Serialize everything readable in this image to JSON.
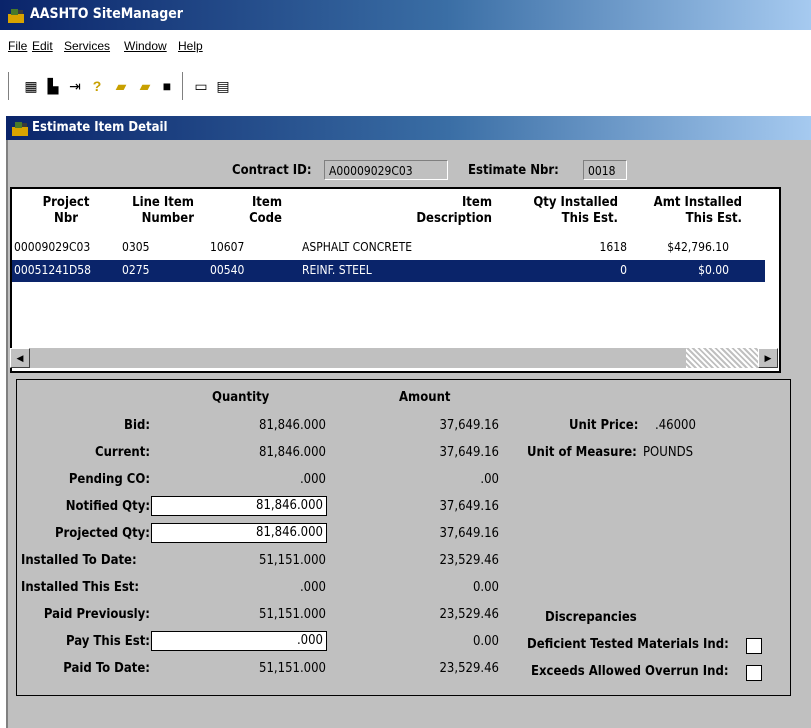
{
  "app": {
    "title": "AASHTO SiteManager"
  },
  "menu": {
    "file": "File",
    "edit": "Edit",
    "services": "Services",
    "window": "Window",
    "help": "Help"
  },
  "toolbar": {
    "icons": [
      "calculator-icon",
      "save-disk-icon",
      "exit-door-icon",
      "help-icon",
      "open-folder-icon",
      "open-folder-2-icon",
      "save-icon",
      "comment-icon",
      "window-list-icon"
    ]
  },
  "child": {
    "title": "Estimate Item Detail"
  },
  "header": {
    "contract_label": "Contract ID:",
    "contract_value": "A00009029C03",
    "estimate_label": "Estimate Nbr:",
    "estimate_value": "0018"
  },
  "grid": {
    "columns": [
      {
        "l1": "Project",
        "l2": "Nbr"
      },
      {
        "l1": "Line Item",
        "l2": "Number"
      },
      {
        "l1": "Item",
        "l2": "Code"
      },
      {
        "l1": "Item",
        "l2": "Description"
      },
      {
        "l1": "Qty Installed",
        "l2": "This Est."
      },
      {
        "l1": "Amt Installed",
        "l2": "This Est."
      }
    ],
    "rows": [
      {
        "project": "00009029C03",
        "line": "0305",
        "code": "10607",
        "desc": "ASPHALT CONCRETE",
        "qty": "1618",
        "amt": "$42,796.10",
        "selected": false
      },
      {
        "project": "00051241D58",
        "line": "0275",
        "code": "00540",
        "desc": "REINF. STEEL",
        "qty": "0",
        "amt": "$0.00",
        "selected": true
      }
    ]
  },
  "detail": {
    "quantity_header": "Quantity",
    "amount_header": "Amount",
    "rows": [
      {
        "label": "Bid:",
        "qty": "81,846.000",
        "amt": "37,649.16"
      },
      {
        "label": "Current:",
        "qty": "81,846.000",
        "amt": "37,649.16"
      },
      {
        "label": "Pending CO:",
        "qty": ".000",
        "amt": ".00"
      },
      {
        "label": "Notified Qty:",
        "qty": "81,846.000",
        "amt": "37,649.16"
      },
      {
        "label": "Projected Qty:",
        "qty": "81,846.000",
        "amt": "37,649.16"
      },
      {
        "label": "Installed To Date:",
        "qty": "51,151.000",
        "amt": "23,529.46"
      },
      {
        "label": "Installed This Est:",
        "qty": ".000",
        "amt": "0.00"
      },
      {
        "label": "Paid Previously:",
        "qty": "51,151.000",
        "amt": "23,529.46"
      },
      {
        "label": "Pay This Est:",
        "qty": ".000",
        "amt": "0.00"
      },
      {
        "label": "Paid To Date:",
        "qty": "51,151.000",
        "amt": "23,529.46"
      }
    ],
    "unit_price_label": "Unit Price:",
    "unit_price_value": ".46000",
    "uom_label": "Unit of Measure:",
    "uom_value": "POUNDS",
    "discrepancies": "Discrepancies",
    "deficient_label": "Deficient Tested Materials Ind:",
    "exceeds_label": "Exceeds Allowed Overrun Ind:"
  }
}
